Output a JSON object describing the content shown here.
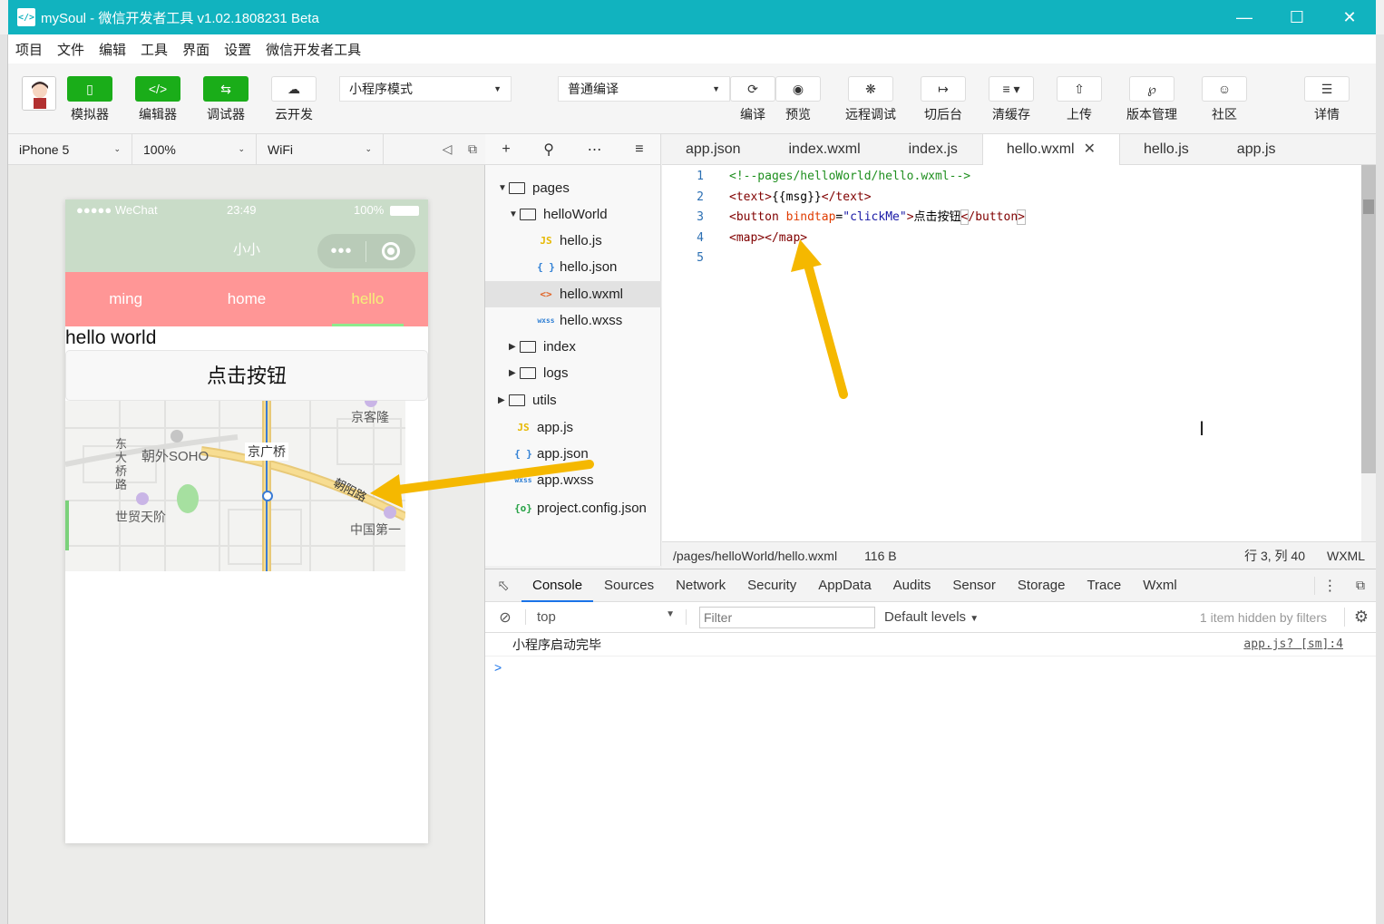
{
  "window": {
    "title": "mySoul - 微信开发者工具 v1.02.1808231 Beta"
  },
  "menu": [
    "项目",
    "文件",
    "编辑",
    "工具",
    "界面",
    "设置",
    "微信开发者工具"
  ],
  "toolbar": {
    "simulator": "模拟器",
    "editor": "编辑器",
    "debugger": "调试器",
    "cloud": "云开发",
    "mode": "小程序模式",
    "compile_mode": "普通编译",
    "compile": "编译",
    "preview": "预览",
    "remote_debug": "远程调试",
    "background": "切后台",
    "clear_cache": "清缓存",
    "upload": "上传",
    "version": "版本管理",
    "community": "社区",
    "details": "详情"
  },
  "sim_bar": {
    "device": "iPhone 5",
    "zoom": "100%",
    "network": "WiFi"
  },
  "phone": {
    "status_signal": "●●●●● WeChat",
    "status_time": "23:49",
    "status_battery": "100%",
    "nav_title": "小小",
    "tabs": [
      "ming",
      "home",
      "hello"
    ],
    "hello_text": "hello world",
    "button_text": "点击按钮",
    "map_labels": {
      "jingkelong": "京客隆",
      "chaowai": "朝外SOHO",
      "jingguangqiao": "京广桥",
      "dongdaqiao": "东大桥路",
      "chaoyang": "朝阳路",
      "shimao": "世贸天阶",
      "zhongguo": "中国第一"
    }
  },
  "file_tree": {
    "pages": "pages",
    "helloWorld": "helloWorld",
    "hello_js": "hello.js",
    "hello_json": "hello.json",
    "hello_wxml": "hello.wxml",
    "hello_wxss": "hello.wxss",
    "index": "index",
    "logs": "logs",
    "utils": "utils",
    "app_js": "app.js",
    "app_json": "app.json",
    "app_wxss": "app.wxss",
    "project_config": "project.config.json"
  },
  "editor_tabs": [
    "app.json",
    "index.wxml",
    "index.js",
    "hello.wxml",
    "hello.js",
    "app.js"
  ],
  "code": {
    "line_numbers": [
      "1",
      "2",
      "3",
      "4",
      "5"
    ],
    "l1": "<!--pages/helloWorld/hello.wxml-->",
    "l2_open": "<text>",
    "l2_text": "{{msg}}",
    "l2_close": "</text>",
    "l3_open": "<button ",
    "l3_attr": "bindtap",
    "l3_eq": "=",
    "l3_val": "\"clickMe\"",
    "l3_gt": ">",
    "l3_text": "点击按钮",
    "l3_lt": "<",
    "l3_close": "/button",
    "l3_end": ">",
    "l4": "<map></map>"
  },
  "status_bar": {
    "path": "/pages/helloWorld/hello.wxml",
    "size": "116 B",
    "cursor": "行 3, 列 40",
    "lang": "WXML"
  },
  "devtools": {
    "tabs": [
      "Console",
      "Sources",
      "Network",
      "Security",
      "AppData",
      "Audits",
      "Sensor",
      "Storage",
      "Trace",
      "Wxml"
    ],
    "context": "top",
    "filter_placeholder": "Filter",
    "levels": "Default levels",
    "hidden": "1 item hidden by filters",
    "log_message": "小程序启动完毕",
    "log_source": "app.js? [sm]:4",
    "prompt": ">"
  },
  "colors": {
    "title_bar": "#11b3bf",
    "green": "#1aad19",
    "tabbar": "#ff9696",
    "arrow": "#f5b800"
  }
}
